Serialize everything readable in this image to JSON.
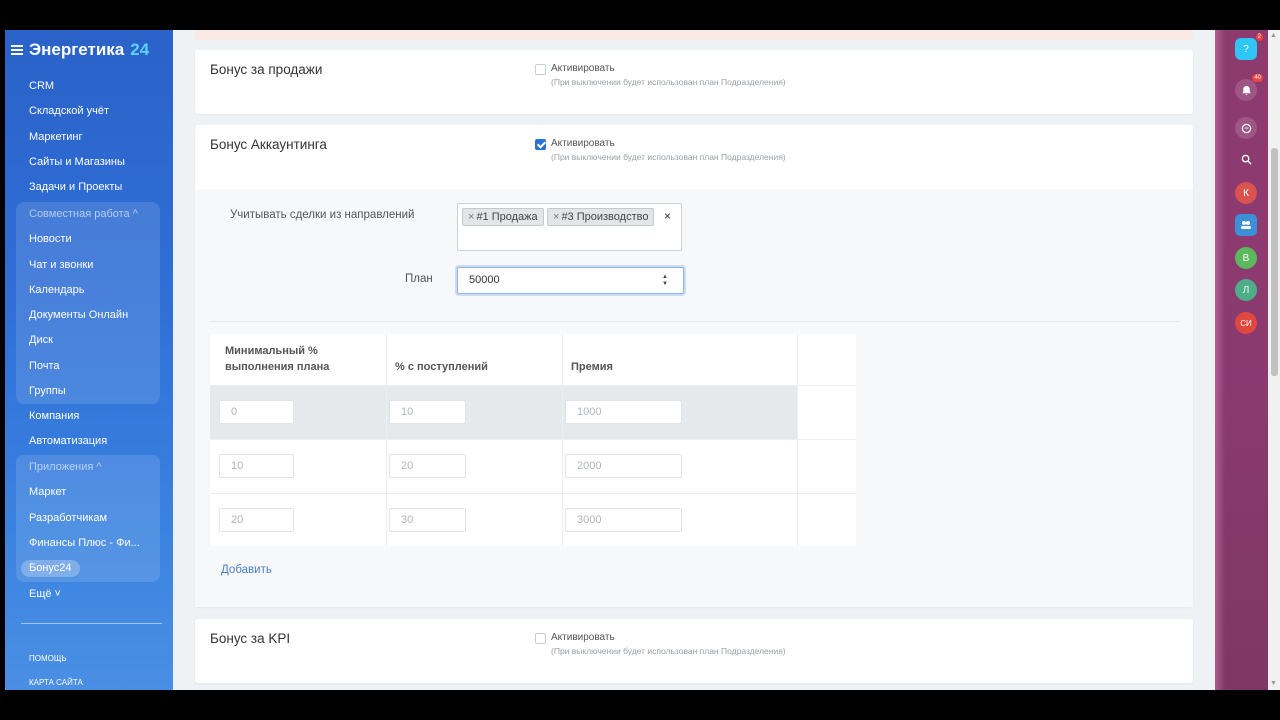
{
  "sidebar": {
    "brand_name": "Энергетика",
    "brand_num": "24",
    "items_top": [
      "CRM",
      "Складской учёт",
      "Маркетинг",
      "Сайты и Магазины",
      "Задачи и Проекты"
    ],
    "group1_header": "Совместная работа ^",
    "group1_items": [
      "Новости",
      "Чат и звонки",
      "Календарь",
      "Документы Онлайн",
      "Диск",
      "Почта",
      "Группы"
    ],
    "items_mid": [
      "Компания",
      "Автоматизация"
    ],
    "group2_header": "Приложения ^",
    "group2_items": [
      "Маркет",
      "Разработчикам",
      "Финансы Плюс - Фи..."
    ],
    "group2_active": "Бонус24",
    "more": "Ещё ˅",
    "help": "ПОМОЩЬ",
    "sitemap": "КАРТА САЙТА"
  },
  "cards": {
    "sales": {
      "title": "Бонус за продажи",
      "checkbox_label": "Активировать",
      "hint": "(При выключении будет использован план Подразделения)",
      "checked": false
    },
    "accounting": {
      "title": "Бонус Аккаунтинга",
      "checkbox_label": "Активировать",
      "hint": "(При выключении будет использован план Подразделения)",
      "checked": true,
      "directions_label": "Учитывать сделки из направлений",
      "tags": [
        "#1 Продажа",
        "#3 Производство"
      ],
      "tag_remove": "×",
      "clear": "×",
      "plan_label": "План",
      "plan_value": "50000",
      "table": {
        "headers": [
          "Минимальный % выполнения плана",
          "% с поступлений",
          "Премия"
        ],
        "rows": [
          [
            "0",
            "10",
            "1000"
          ],
          [
            "10",
            "20",
            "2000"
          ],
          [
            "20",
            "30",
            "3000"
          ]
        ]
      },
      "add_label": "Добавить"
    },
    "kpi": {
      "title": "Бонус за KPI",
      "checkbox_label": "Активировать",
      "hint": "(При выключении будет использован план Подразделения)",
      "checked": false
    }
  },
  "rail": {
    "help_badge": "2",
    "notif_badge": "40",
    "avatars": [
      {
        "initials": "К",
        "color": "#d9534f"
      },
      {
        "initials": "В",
        "color": "#5cb85c"
      },
      {
        "initials": "Л",
        "color": "#4caf88"
      },
      {
        "initials": "СИ",
        "color": "#e0473f"
      }
    ]
  }
}
